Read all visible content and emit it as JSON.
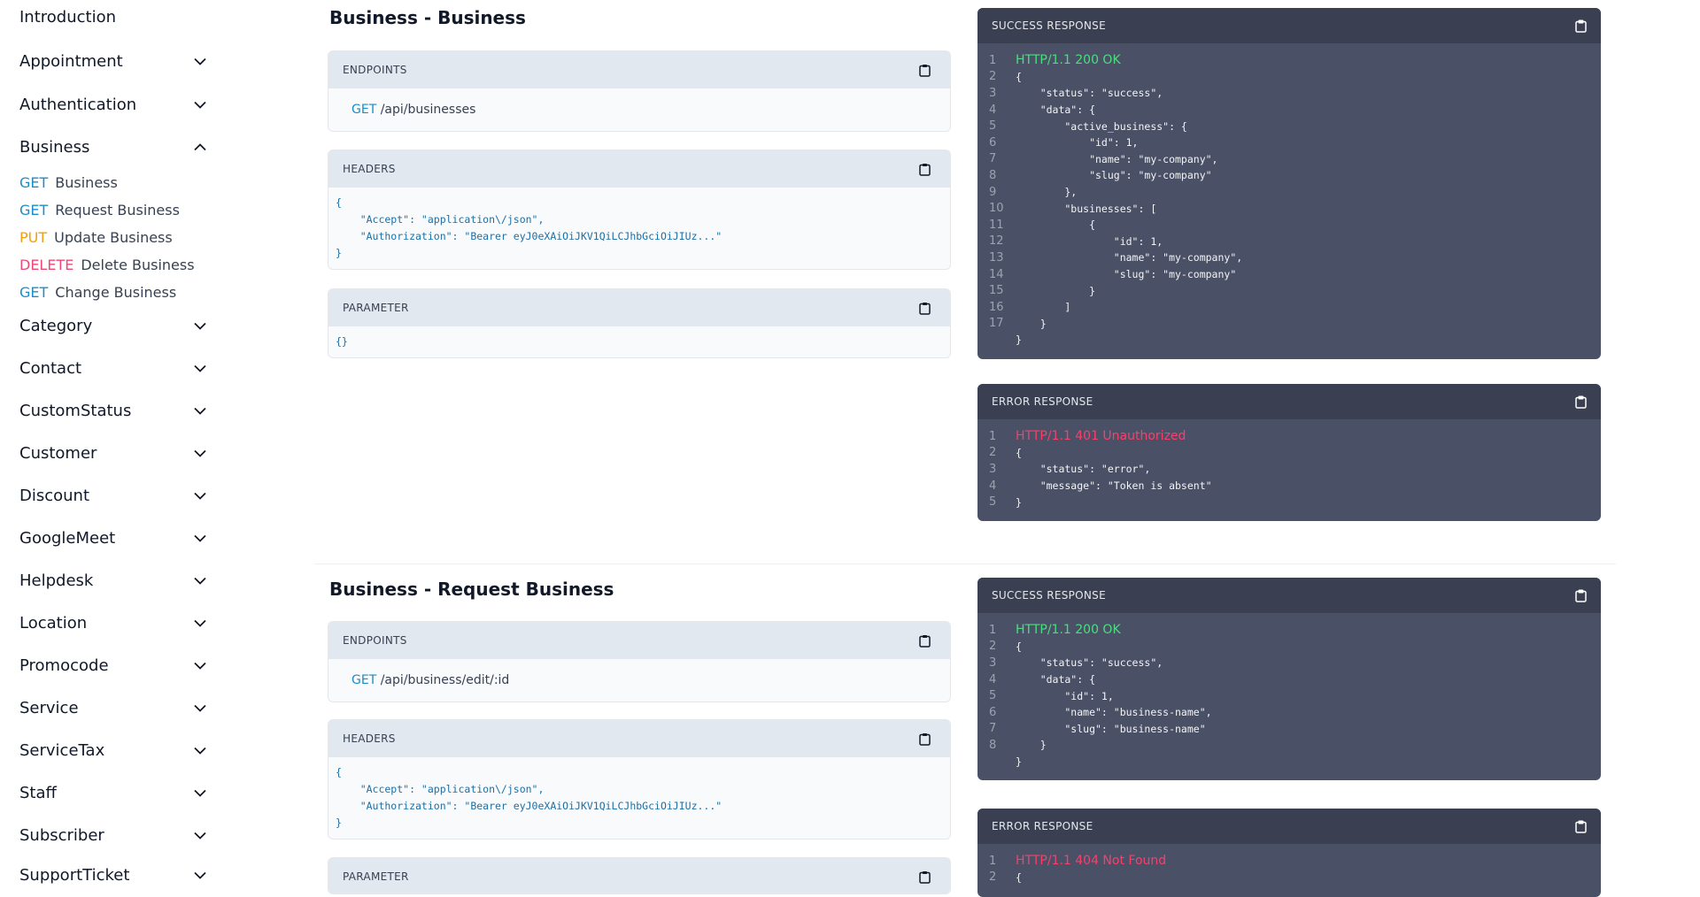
{
  "sidebar": {
    "intro": "Introduction",
    "groups_top": [
      {
        "label": "Appointment"
      },
      {
        "label": "Authentication"
      }
    ],
    "business": {
      "label": "Business",
      "items": [
        {
          "method": "GET",
          "label": "Business"
        },
        {
          "method": "GET",
          "label": "Request Business"
        },
        {
          "method": "PUT",
          "label": "Update Business"
        },
        {
          "method": "DELETE",
          "label": "Delete Business"
        },
        {
          "method": "GET",
          "label": "Change Business"
        }
      ]
    },
    "groups_bottom": [
      {
        "label": "Category"
      },
      {
        "label": "Contact"
      },
      {
        "label": "CustomStatus"
      },
      {
        "label": "Customer"
      },
      {
        "label": "Discount"
      },
      {
        "label": "GoogleMeet"
      },
      {
        "label": "Helpdesk"
      },
      {
        "label": "Location"
      },
      {
        "label": "Promocode"
      },
      {
        "label": "Service"
      },
      {
        "label": "ServiceTax"
      },
      {
        "label": "Staff"
      },
      {
        "label": "Subscriber"
      },
      {
        "label": "SupportTicket"
      }
    ]
  },
  "sections": [
    {
      "title": "Business - Business",
      "endpoints_label": "ENDPOINTS",
      "endpoint_method": "GET",
      "endpoint_path": "/api/businesses",
      "headers_label": "HEADERS",
      "headers_code": "{\n    \"Accept\": \"application\\/json\",\n    \"Authorization\": \"Bearer eyJ0eXAiOiJKV1QiLCJhbGciOiJIUz...\"\n}",
      "parameter_label": "PARAMETER",
      "parameter_code": "{}",
      "success": {
        "label": "SUCCESS RESPONSE",
        "status": "HTTP/1.1 200 OK",
        "lines": [
          "{",
          "    \"status\": \"success\",",
          "    \"data\": {",
          "        \"active_business\": {",
          "            \"id\": 1,",
          "            \"name\": \"my-company\",",
          "            \"slug\": \"my-company\"",
          "        },",
          "        \"businesses\": [",
          "            {",
          "                \"id\": 1,",
          "                \"name\": \"my-company\",",
          "                \"slug\": \"my-company\"",
          "            }",
          "        ]",
          "    }",
          "}"
        ]
      },
      "error": {
        "label": "ERROR RESPONSE",
        "status": "HTTP/1.1 401 Unauthorized",
        "lines": [
          "{",
          "    \"status\": \"error\",",
          "    \"message\": \"Token is absent\"",
          "}"
        ]
      }
    },
    {
      "title": "Business - Request Business",
      "endpoints_label": "ENDPOINTS",
      "endpoint_method": "GET",
      "endpoint_path": "/api/business/edit/:id",
      "headers_label": "HEADERS",
      "headers_code": "{\n    \"Accept\": \"application\\/json\",\n    \"Authorization\": \"Bearer eyJ0eXAiOiJKV1QiLCJhbGciOiJIUz...\"\n}",
      "parameter_label": "PARAMETER",
      "success": {
        "label": "SUCCESS RESPONSE",
        "status": "HTTP/1.1 200 OK",
        "lines": [
          "{",
          "    \"status\": \"success\",",
          "    \"data\": {",
          "        \"id\": 1,",
          "        \"name\": \"business-name\",",
          "        \"slug\": \"business-name\"",
          "    }",
          "}"
        ]
      },
      "error": {
        "label": "ERROR RESPONSE",
        "status": "HTTP/1.1 404 Not Found",
        "lines": [
          "{"
        ]
      }
    }
  ]
}
